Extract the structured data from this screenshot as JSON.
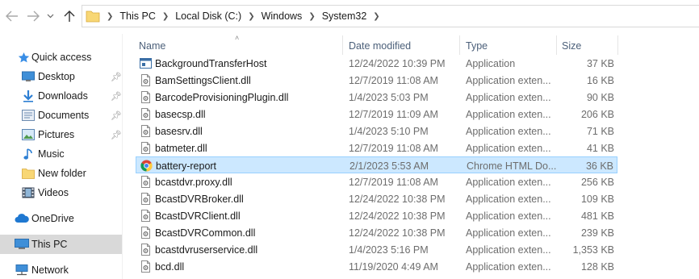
{
  "address": {
    "breadcrumbs": [
      "This PC",
      "Local Disk (C:)",
      "Windows",
      "System32"
    ]
  },
  "sidebar": {
    "items": [
      {
        "label": "Quick access",
        "icon": "star-icon",
        "level": 0,
        "pinned": false,
        "selected": false
      },
      {
        "label": "Desktop",
        "icon": "desktop-folder-icon",
        "level": 1,
        "pinned": true,
        "selected": false
      },
      {
        "label": "Downloads",
        "icon": "downloads-folder-icon",
        "level": 1,
        "pinned": true,
        "selected": false
      },
      {
        "label": "Documents",
        "icon": "documents-folder-icon",
        "level": 1,
        "pinned": true,
        "selected": false
      },
      {
        "label": "Pictures",
        "icon": "pictures-folder-icon",
        "level": 1,
        "pinned": true,
        "selected": false
      },
      {
        "label": "Music",
        "icon": "music-icon",
        "level": 1,
        "pinned": false,
        "selected": false
      },
      {
        "label": "New folder",
        "icon": "folder-icon",
        "level": 1,
        "pinned": false,
        "selected": false
      },
      {
        "label": "Videos",
        "icon": "videos-folder-icon",
        "level": 1,
        "pinned": false,
        "selected": false
      },
      {
        "label": "OneDrive",
        "icon": "cloud-icon",
        "level": 0,
        "pinned": false,
        "selected": false
      },
      {
        "label": "This PC",
        "icon": "computer-icon",
        "level": 0,
        "pinned": false,
        "selected": true
      },
      {
        "label": "Network",
        "icon": "network-icon",
        "level": 0,
        "pinned": false,
        "selected": false
      }
    ]
  },
  "columns": {
    "name": "Name",
    "date": "Date modified",
    "type": "Type",
    "size": "Size"
  },
  "files": [
    {
      "name": "BackgroundTransferHost",
      "date": "12/24/2022 10:39 PM",
      "type": "Application",
      "size": "37 KB",
      "icon": "application-icon",
      "selected": false
    },
    {
      "name": "BamSettingsClient.dll",
      "date": "12/7/2019 11:08 AM",
      "type": "Application exten...",
      "size": "16 KB",
      "icon": "dll-file-icon",
      "selected": false
    },
    {
      "name": "BarcodeProvisioningPlugin.dll",
      "date": "1/4/2023 5:03 PM",
      "type": "Application exten...",
      "size": "90 KB",
      "icon": "dll-file-icon",
      "selected": false
    },
    {
      "name": "basecsp.dll",
      "date": "12/7/2019 11:09 AM",
      "type": "Application exten...",
      "size": "206 KB",
      "icon": "dll-file-icon",
      "selected": false
    },
    {
      "name": "basesrv.dll",
      "date": "1/4/2023 5:10 PM",
      "type": "Application exten...",
      "size": "71 KB",
      "icon": "dll-file-icon",
      "selected": false
    },
    {
      "name": "batmeter.dll",
      "date": "12/7/2019 11:08 AM",
      "type": "Application exten...",
      "size": "41 KB",
      "icon": "dll-file-icon",
      "selected": false
    },
    {
      "name": "battery-report",
      "date": "2/1/2023 5:53 AM",
      "type": "Chrome HTML Do...",
      "size": "36 KB",
      "icon": "chrome-icon",
      "selected": true
    },
    {
      "name": "bcastdvr.proxy.dll",
      "date": "12/7/2019 11:08 AM",
      "type": "Application exten...",
      "size": "256 KB",
      "icon": "dll-file-icon",
      "selected": false
    },
    {
      "name": "BcastDVRBroker.dll",
      "date": "12/24/2022 10:38 PM",
      "type": "Application exten...",
      "size": "109 KB",
      "icon": "dll-file-icon",
      "selected": false
    },
    {
      "name": "BcastDVRClient.dll",
      "date": "12/24/2022 10:38 PM",
      "type": "Application exten...",
      "size": "481 KB",
      "icon": "dll-file-icon",
      "selected": false
    },
    {
      "name": "BcastDVRCommon.dll",
      "date": "12/24/2022 10:38 PM",
      "type": "Application exten...",
      "size": "239 KB",
      "icon": "dll-file-icon",
      "selected": false
    },
    {
      "name": "bcastdvruserservice.dll",
      "date": "1/4/2023 5:16 PM",
      "type": "Application exten...",
      "size": "1,353 KB",
      "icon": "dll-file-icon",
      "selected": false
    },
    {
      "name": "bcd.dll",
      "date": "11/19/2020 4:49 AM",
      "type": "Application exten...",
      "size": "128 KB",
      "icon": "dll-file-icon",
      "selected": false
    }
  ],
  "colors": {
    "selection_fill": "#cce8ff",
    "selection_border": "#99d1ff",
    "sidebar_selected": "#d9d9d9",
    "header_text": "#4c607a",
    "folder_yellow": "#f8d775"
  }
}
